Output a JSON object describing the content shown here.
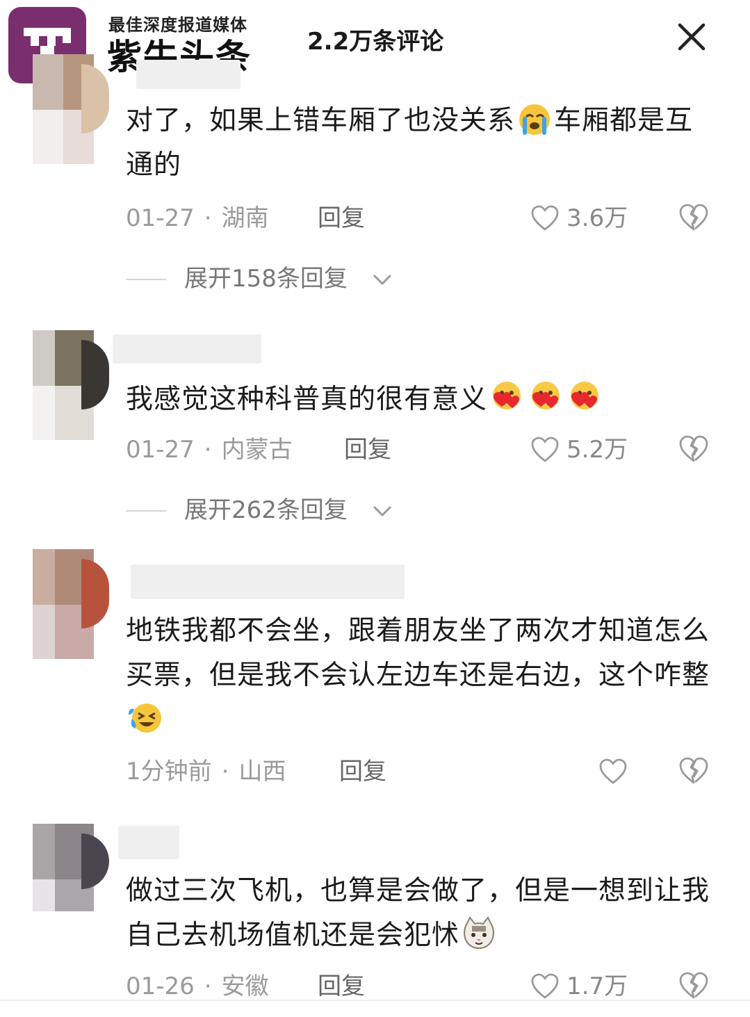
{
  "header": {
    "brand_sub": "最佳深度报道媒体",
    "brand_main": "紫牛头条",
    "title": "2.2万条评论",
    "close_icon": "close-icon",
    "brand_color": "#7a2e6e"
  },
  "comments": [
    {
      "text": "对了，如果上错车厢了也没关系",
      "text_after_emoji": "车厢都是互通的",
      "emoji": "crying-face-icon",
      "date": "01-27",
      "location": "湖南",
      "reply_label": "回复",
      "likes": "3.6万",
      "expand_label": "展开158条回复"
    },
    {
      "text": "我感觉这种科普真的很有意义",
      "emoji": "heart-hug-face-icon",
      "date": "01-27",
      "location": "内蒙古",
      "reply_label": "回复",
      "likes": "5.2万",
      "expand_label": "展开262条回复"
    },
    {
      "text": "地铁我都不会坐，跟着朋友坐了两次才知道怎么买票，但是我不会认左边车还是右边，这个咋整",
      "emoji": "laughing-tears-face-icon",
      "date": "1分钟前",
      "location": "山西",
      "reply_label": "回复",
      "likes": ""
    },
    {
      "text": "做过三次飞机，也算是会做了，但是一想到让我自己去机场值机还是会犯怵",
      "emoji": "cat-face-icon",
      "date": "01-26",
      "location": "安徽",
      "reply_label": "回复",
      "likes": "1.7万"
    }
  ]
}
